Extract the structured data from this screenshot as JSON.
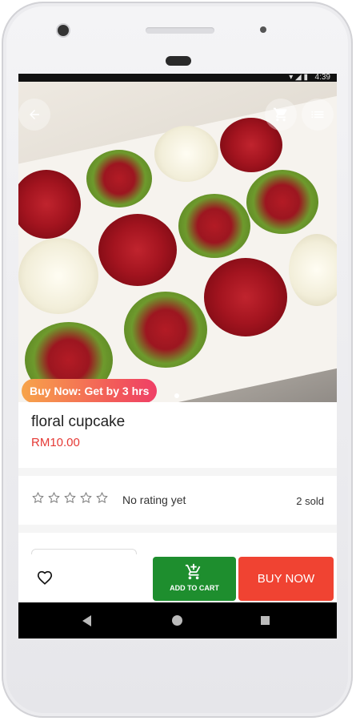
{
  "status_bar": {
    "time": "4:39",
    "signal": "▾ ◢ ▮"
  },
  "header": {
    "back_icon": "arrow-left-icon",
    "cart_icon": "cart-icon",
    "menu_icon": "list-menu-icon"
  },
  "hero": {
    "badge": "Buy Now: Get by 3 hrs",
    "image_alt": "box of rose cupcakes",
    "page_count": 2,
    "active_page": 1
  },
  "product": {
    "title": "floral cupcake",
    "price": "RM10.00"
  },
  "rating": {
    "text": "No rating yet",
    "stars": 5,
    "sold": "2 sold"
  },
  "actions": {
    "wishlist_icon": "heart-icon",
    "add_to_cart": "ADD TO CART",
    "buy_now": "BUY NOW"
  },
  "colors": {
    "add_to_cart": "#1e8e2e",
    "buy_now": "#f04332",
    "price": "#e53935"
  }
}
